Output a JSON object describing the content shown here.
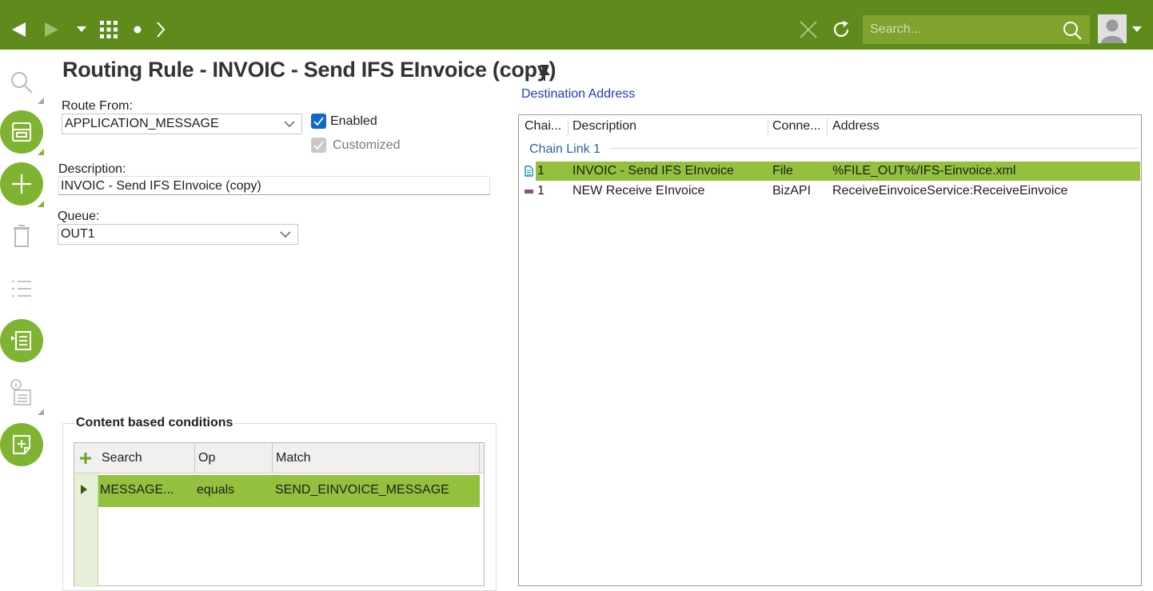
{
  "toolbar": {
    "search_placeholder": "Search...",
    "colors": {
      "bar": "#5f8b1c",
      "search": "#7fa32d"
    }
  },
  "page": {
    "title": "Routing Rule - INVOIC - Send IFS EInvoice (copy)"
  },
  "form": {
    "route_from_label": "Route From:",
    "route_from_value": "APPLICATION_MESSAGE",
    "enabled_label": "Enabled",
    "enabled_checked": true,
    "customized_label": "Customized",
    "customized_checked": true,
    "description_label": "Description:",
    "description_value": "INVOIC - Send IFS EInvoice (copy)",
    "queue_label": "Queue:",
    "queue_value": "OUT1"
  },
  "destination": {
    "link_label": "Destination Address",
    "columns": [
      "Chai...",
      "Description",
      "Conne...",
      "Address"
    ],
    "group_label": "Chain Link 1",
    "rows": [
      {
        "chain": "1",
        "description": "INVOIC - Send IFS EInvoice",
        "connector": "File",
        "address": "%FILE_OUT%/IFS-Einvoice.xml",
        "icon": "file-icon",
        "selected": true
      },
      {
        "chain": "1",
        "description": "NEW Receive EInvoice",
        "connector": "BizAPI",
        "address": "ReceiveEinvoiceService:ReceiveEinvoice",
        "icon": "bizapi-icon",
        "selected": false
      }
    ]
  },
  "conditions": {
    "title": "Content based conditions",
    "columns": [
      "Search",
      "Op",
      "Match"
    ],
    "rows": [
      {
        "search": "MESSAGE...",
        "op": "equals",
        "match": "SEND_EINVOICE_MESSAGE"
      }
    ]
  },
  "colors": {
    "selection": "#93c13e",
    "accent": "#7fb432",
    "link": "#1a3fbf"
  }
}
